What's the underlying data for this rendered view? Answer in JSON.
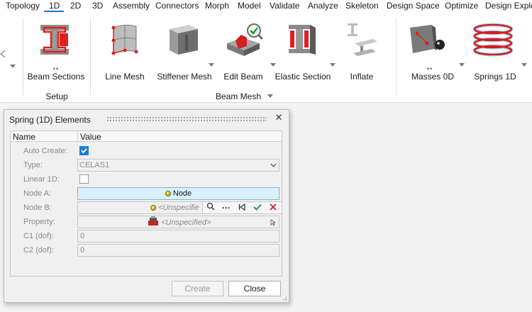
{
  "menubar": {
    "items": [
      "Topology",
      "1D",
      "2D",
      "3D",
      "Assembly",
      "Connectors",
      "Morph",
      "Model",
      "Validate",
      "Analyze",
      "Skeleton",
      "Design Space",
      "Optimize",
      "Design Explor"
    ],
    "active_index": 1,
    "accent": "#1a73c8"
  },
  "ribbon": {
    "tools": [
      {
        "label": "Beam Sections",
        "icon": "beam-sections-icon"
      },
      {
        "label": "Line Mesh",
        "icon": "line-mesh-icon"
      },
      {
        "label": "Stiffener Mesh",
        "icon": "stiffener-mesh-icon"
      },
      {
        "label": "Edit Beam",
        "icon": "edit-beam-icon"
      },
      {
        "label": "Elastic Section",
        "icon": "elastic-section-icon"
      },
      {
        "label": "Inflate",
        "icon": "inflate-icon"
      },
      {
        "label": "Masses 0D",
        "icon": "masses-0d-icon"
      },
      {
        "label": "Springs 1D",
        "icon": "springs-1d-icon"
      }
    ],
    "groups": {
      "setup": "Setup",
      "beam_mesh": "Beam Mesh"
    }
  },
  "dialog": {
    "title": "Spring (1D) Elements",
    "close_glyph": "✕",
    "columns": {
      "name": "Name",
      "value": "Value"
    },
    "rows": {
      "auto_create": {
        "label": "Auto Create:",
        "checked": true
      },
      "type": {
        "label": "Type:",
        "value": "CELAS1"
      },
      "linear_1d": {
        "label": "Linear 1D:",
        "checked": false
      },
      "node_a": {
        "label": "Node A:",
        "value": "Node"
      },
      "node_b": {
        "label": "Node B:",
        "value": "<Unspecifie"
      },
      "property": {
        "label": "Property:",
        "value": "<Unspecified>"
      },
      "c1": {
        "label": "C1 (dof):",
        "value": "0"
      },
      "c2": {
        "label": "C2 (dof):",
        "value": "0"
      }
    },
    "mini_toolbar": {
      "more": "···"
    },
    "buttons": {
      "create": "Create",
      "close": "Close"
    }
  }
}
